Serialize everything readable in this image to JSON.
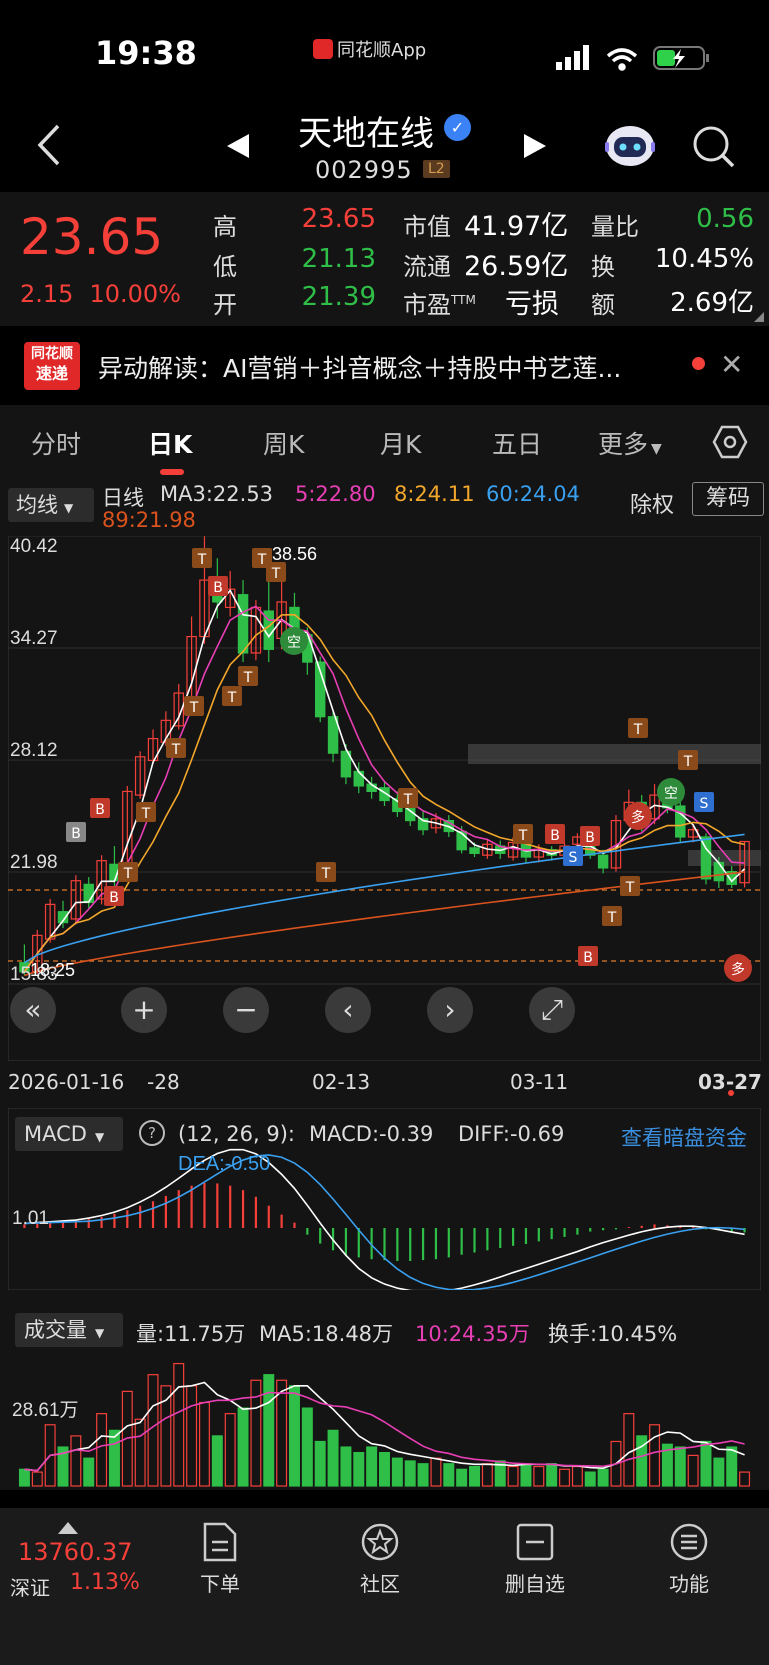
{
  "status": {
    "time": "19:38",
    "app_label": "同花顺App"
  },
  "header": {
    "name": "天地在线",
    "code": "002995",
    "level": "L2"
  },
  "quote": {
    "price": "23.65",
    "change": "2.15",
    "change_pct": "10.00%",
    "high_label": "高",
    "high": "23.65",
    "low_label": "低",
    "low": "21.13",
    "open_label": "开",
    "open": "21.39",
    "mktcap_label": "市值",
    "mktcap": "41.97亿",
    "float_label": "流通",
    "float": "26.59亿",
    "pe_label": "市盈",
    "pe_sup": "TTM",
    "pe": "亏损",
    "vr_label": "量比",
    "vr": "0.56",
    "turnover_label": "换",
    "turnover": "10.45%",
    "amount_label": "额",
    "amount": "2.69亿"
  },
  "news": {
    "logo_line1": "同花顺",
    "logo_line2": "速递",
    "text": "异动解读：AI营销＋抖音概念＋持股中书艺莲..."
  },
  "tabs": [
    "分时",
    "日K",
    "周K",
    "月K",
    "五日",
    "更多"
  ],
  "ma_bar": {
    "select": "均线",
    "period": "日线",
    "ma3": "MA3:22.53",
    "ma5": "5:22.80",
    "ma8": "8:24.11",
    "ma60": "60:24.04",
    "ma89": "89:21.98",
    "ex_rights": "除权",
    "chips": "筹码"
  },
  "kline": {
    "y_ticks": [
      "40.42",
      "34.27",
      "28.12",
      "21.98",
      "15.83"
    ],
    "y_tick_values": [
      40.42,
      34.27,
      28.12,
      21.98,
      15.83
    ],
    "high_marker": "←38.56",
    "bottom_label": "18.25",
    "dates": [
      "2026-01-16",
      "-28",
      "02-13",
      "03-11",
      "03-27"
    ],
    "candles": [
      [
        17.0,
        16.5,
        18.0,
        16.3
      ],
      [
        16.5,
        18.5,
        18.8,
        16.4
      ],
      [
        18.3,
        20.2,
        20.5,
        18.1
      ],
      [
        19.8,
        19.2,
        20.4,
        18.9
      ],
      [
        19.4,
        21.5,
        21.8,
        19.1
      ],
      [
        21.3,
        20.3,
        21.7,
        20.0
      ],
      [
        20.5,
        22.6,
        22.9,
        20.2
      ],
      [
        22.4,
        21.5,
        23.4,
        21.2
      ],
      [
        21.7,
        26.4,
        26.7,
        21.5
      ],
      [
        26.2,
        28.3,
        28.6,
        26.0
      ],
      [
        28.1,
        29.3,
        29.8,
        27.9
      ],
      [
        29.1,
        30.3,
        30.8,
        28.9
      ],
      [
        30.0,
        31.8,
        32.3,
        29.8
      ],
      [
        31.6,
        34.9,
        36.0,
        31.3
      ],
      [
        34.9,
        38.0,
        40.4,
        34.5
      ],
      [
        37.8,
        36.8,
        39.2,
        35.9
      ],
      [
        36.5,
        37.5,
        38.5,
        36.0
      ],
      [
        37.2,
        34.0,
        38.0,
        33.5
      ],
      [
        34.0,
        36.5,
        36.9,
        33.6
      ],
      [
        36.3,
        34.2,
        38.0,
        33.5
      ],
      [
        34.8,
        36.8,
        38.56,
        34.2
      ],
      [
        36.5,
        35.0,
        37.3,
        34.6
      ],
      [
        35.0,
        33.5,
        35.4,
        32.8
      ],
      [
        33.5,
        30.5,
        33.8,
        30.2
      ],
      [
        30.5,
        28.5,
        30.8,
        28.0
      ],
      [
        28.6,
        27.2,
        29.0,
        26.8
      ],
      [
        27.5,
        26.7,
        28.0,
        26.3
      ],
      [
        26.8,
        26.4,
        27.2,
        26.0
      ],
      [
        26.6,
        25.9,
        26.9,
        25.6
      ],
      [
        26.0,
        25.3,
        26.4,
        25.0
      ],
      [
        25.5,
        24.8,
        25.9,
        24.5
      ],
      [
        24.9,
        24.3,
        25.3,
        24.0
      ],
      [
        24.4,
        24.9,
        25.2,
        24.1
      ],
      [
        24.8,
        24.2,
        25.1,
        23.9
      ],
      [
        24.2,
        23.2,
        24.5,
        23.0
      ],
      [
        23.3,
        23.0,
        23.6,
        22.8
      ],
      [
        22.9,
        23.5,
        23.8,
        22.7
      ],
      [
        23.4,
        23.0,
        23.7,
        22.7
      ],
      [
        22.8,
        23.6,
        23.9,
        22.6
      ],
      [
        23.5,
        22.8,
        23.7,
        22.5
      ],
      [
        22.8,
        23.2,
        23.5,
        22.5
      ],
      [
        23.2,
        22.9,
        23.4,
        22.6
      ],
      [
        22.9,
        23.4,
        23.6,
        22.7
      ],
      [
        23.5,
        23.9,
        24.1,
        22.6
      ],
      [
        23.9,
        22.9,
        24.2,
        22.7
      ],
      [
        22.9,
        22.2,
        23.2,
        21.9
      ],
      [
        22.2,
        24.8,
        25.1,
        22.0
      ],
      [
        24.8,
        25.8,
        26.5,
        24.5
      ],
      [
        25.8,
        24.9,
        26.2,
        24.2
      ],
      [
        24.9,
        26.2,
        26.8,
        24.6
      ],
      [
        26.0,
        25.5,
        26.7,
        25.2
      ],
      [
        25.6,
        23.9,
        25.9,
        23.6
      ],
      [
        23.9,
        24.3,
        24.6,
        23.6
      ],
      [
        23.9,
        21.6,
        24.1,
        21.3
      ],
      [
        22.5,
        21.5,
        22.8,
        21.1
      ],
      [
        22.0,
        21.3,
        22.3,
        21.1
      ],
      [
        21.39,
        23.65,
        23.65,
        21.13
      ]
    ]
  },
  "controls": [
    "«",
    "+",
    "−",
    "‹",
    "›",
    "⤢"
  ],
  "macd": {
    "select": "MACD",
    "params": "(12, 26, 9):",
    "macd": "MACD:-0.39",
    "diff": "DIFF:-0.69",
    "dea": "DEA:-0.50",
    "link": "查看暗盘资金",
    "y_tick": "1.01",
    "y_tick_value": 1.01,
    "bars": [
      0.08,
      0.1,
      0.12,
      0.14,
      0.16,
      0.2,
      0.25,
      0.32,
      0.4,
      0.5,
      0.6,
      0.72,
      0.85,
      0.95,
      1.01,
      1.0,
      0.95,
      0.85,
      0.7,
      0.5,
      0.3,
      0.12,
      -0.15,
      -0.35,
      -0.5,
      -0.6,
      -0.66,
      -0.7,
      -0.72,
      -0.74,
      -0.74,
      -0.72,
      -0.7,
      -0.66,
      -0.6,
      -0.55,
      -0.5,
      -0.45,
      -0.4,
      -0.36,
      -0.3,
      -0.25,
      -0.2,
      -0.15,
      -0.08,
      -0.05,
      -0.03,
      0.02,
      0.05,
      0.08,
      0.06,
      0.03,
      0.02,
      -0.03,
      -0.05,
      -0.08,
      -0.1
    ]
  },
  "volume": {
    "select": "成交量",
    "vol": "量:11.75万",
    "ma5": "MA5:18.48万",
    "ma10": "10:24.35万",
    "turnover": "换手:10.45%",
    "y_tick": "28.61万",
    "y_tick_value": 28.61,
    "bars": [
      6,
      5,
      22,
      14,
      18,
      10,
      26,
      20,
      34,
      24,
      40,
      36,
      44,
      36,
      30,
      18,
      26,
      28,
      38,
      40,
      38,
      36,
      28,
      16,
      20,
      14,
      12,
      14,
      12,
      10,
      9,
      8,
      10,
      8,
      6,
      7,
      8,
      9,
      7,
      8,
      7,
      8,
      6,
      7,
      5,
      6,
      16,
      26,
      18,
      22,
      15,
      14,
      11,
      16,
      10,
      14,
      5
    ]
  },
  "bottom": {
    "index_value": "13760.37",
    "index_name": "深证",
    "index_pct": "1.13%",
    "nav": [
      "下单",
      "社区",
      "删自选",
      "功能"
    ]
  },
  "colors": {
    "up": "#f5403a",
    "down": "#2fbf48",
    "ma3": "#ffffff",
    "ma5": "#e83fb5",
    "ma8": "#f2a72b",
    "ma60": "#3aa0f0",
    "ma89": "#d9531e"
  }
}
